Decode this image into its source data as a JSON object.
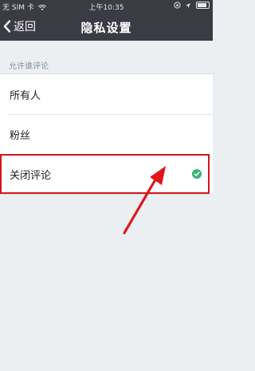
{
  "status_bar": {
    "carrier": "无 SIM 卡 ",
    "time": "上午10:35"
  },
  "nav": {
    "back_label": "返回",
    "title": "隐私设置"
  },
  "section": {
    "header": "允许谁评论",
    "options": [
      {
        "label": "所有人",
        "selected": false
      },
      {
        "label": "粉丝",
        "selected": false
      },
      {
        "label": "关闭评论",
        "selected": true
      }
    ]
  },
  "colors": {
    "nav_background": "#3a3b43",
    "check_green": "#3bb27a",
    "highlight_red": "#d0161f"
  }
}
